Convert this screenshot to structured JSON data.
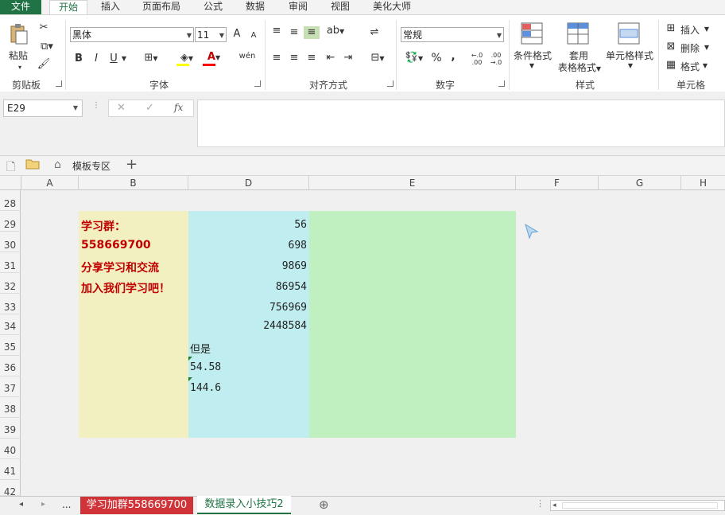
{
  "tabs": [
    "文件",
    "开始",
    "插入",
    "页面布局",
    "公式",
    "数据",
    "审阅",
    "视图",
    "美化大师"
  ],
  "clipboard": {
    "paste": "粘贴",
    "label": "剪贴板"
  },
  "font": {
    "name": "黑体",
    "size": "11",
    "label": "字体",
    "bold": "B",
    "italic": "I",
    "underline": "U",
    "phonetic": "wén",
    "grow": "A",
    "shrink": "A"
  },
  "alignment": {
    "label": "对齐方式"
  },
  "number": {
    "format": "常规",
    "label": "数字",
    "percent": "%",
    "comma": ",",
    "inc_decimal": "←.0 .00",
    "dec_decimal": ".00 →.0"
  },
  "styles": {
    "conditional": "条件格式",
    "table_format_1": "套用",
    "table_format_2": "表格格式",
    "cell_styles": "单元格样式",
    "label": "样式"
  },
  "cells_group": {
    "insert": "插入",
    "delete": "删除",
    "format": "格式",
    "label": "单元格"
  },
  "formula_bar": {
    "name_box": "E29",
    "fx": "fx",
    "cancel": "✕",
    "enter": "✓",
    "value": ""
  },
  "template_bar": {
    "label": "模板专区",
    "add": "+"
  },
  "columns": [
    "A",
    "B",
    "D",
    "E",
    "F",
    "G",
    "H"
  ],
  "rows": [
    "28",
    "29",
    "30",
    "31",
    "32",
    "33",
    "34",
    "35",
    "36",
    "37",
    "38",
    "39",
    "40",
    "41",
    "42"
  ],
  "b_cells": [
    "学习群：",
    "558669700",
    "分享学习和交流",
    "加入我们学习吧！"
  ],
  "d_numbers": [
    "56",
    "698",
    "9869",
    "86954",
    "756969",
    "2448584"
  ],
  "d_texts": [
    "但是",
    "54.58",
    "144.6"
  ],
  "sheet_tabs": {
    "more": "...",
    "tab1": "学习加群558669700",
    "tab2": "数据录入小技巧2",
    "add": "⊕"
  },
  "colors": {
    "excel_green": "#217346",
    "yellow_fill": "#f2f0c0",
    "cyan_fill": "#c0eef0",
    "green_fill": "#c0f0c0",
    "red_text": "#c00000",
    "active_tab": "#d13438"
  }
}
